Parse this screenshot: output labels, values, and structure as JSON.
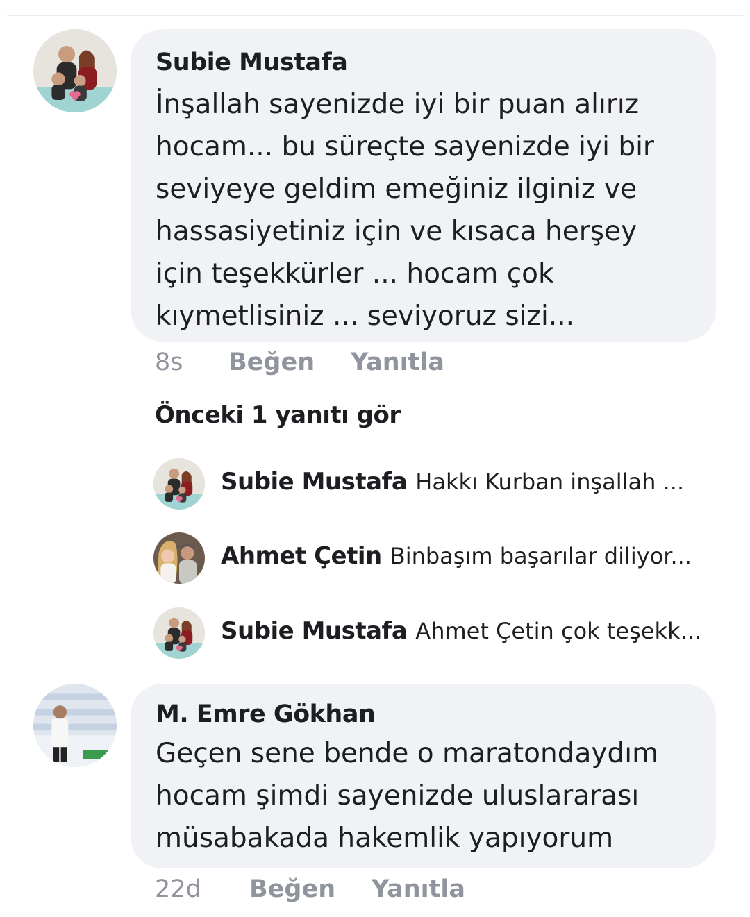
{
  "comments": [
    {
      "author": "Subie Mustafa",
      "avatar_icon": "family-photo-avatar",
      "text_lines": [
        "İnşallah sayenizde iyi bir puan alırız",
        "hocam... bu süreçte sayenizde iyi bir",
        "seviyeye geldim emeğiniz ilginiz ve",
        "hassasiyetiniz için ve kısaca herşey",
        "için teşekkürler ... hocam çok",
        "kıymetlisiniz ... seviyoruz sizi..."
      ],
      "time": "8s",
      "like_label": "Beğen",
      "reply_label": "Yanıtla"
    },
    {
      "author": "M. Emre Gökhan",
      "avatar_icon": "wrestling-championship-avatar",
      "text_lines": [
        "Geçen sene bende o maratondaydım",
        "hocam şimdi sayenizde uluslararası",
        "müsabakada hakemlik yapıyorum"
      ],
      "time": "22d",
      "like_label": "Beğen",
      "reply_label": "Yanıtla"
    }
  ],
  "replies_section": {
    "view_previous_label": "Önceki 1 yanıtı gör",
    "replies": [
      {
        "author": "Subie Mustafa",
        "snippet": "Hakkı Kurban inşallah ...",
        "avatar_icon": "family-photo-avatar"
      },
      {
        "author": "Ahmet Çetin",
        "snippet": "Binbaşım başarılar diliyor...",
        "avatar_icon": "couple-photo-avatar"
      },
      {
        "author": "Subie Mustafa",
        "snippet": "Ahmet Çetin çok teşekk...",
        "avatar_icon": "family-photo-avatar"
      }
    ]
  },
  "colors": {
    "bubble_background": "#f1f2f6",
    "text": "#1c1e21",
    "meta_text": "#90949c"
  }
}
